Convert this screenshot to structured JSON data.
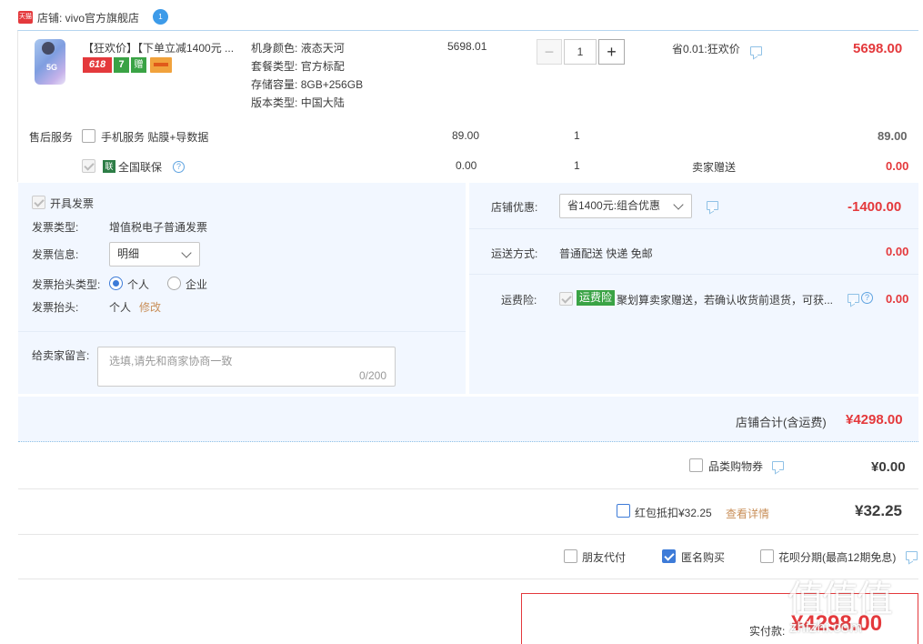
{
  "shop": {
    "icon_text": "天猫",
    "label": "店铺: vivo官方旗舰店",
    "badge": "1"
  },
  "product": {
    "title": "【狂欢价】【下单立减1400元 ...",
    "badges": [
      "618",
      "7",
      "赠",
      "卡"
    ],
    "specs": [
      {
        "key": "机身颜色:",
        "value": "液态天河"
      },
      {
        "key": "套餐类型:",
        "value": "官方标配"
      },
      {
        "key": "存储容量:",
        "value": "8GB+256GB"
      },
      {
        "key": "版本类型:",
        "value": "中国大陆"
      }
    ],
    "unit_price": "5698.01",
    "qty": "1",
    "minus": "−",
    "plus": "+",
    "promo": "省0.01:狂欢价",
    "subtotal": "5698.00"
  },
  "aftersale": {
    "label": "售后服务",
    "service1": {
      "name": "手机服务 贴膜+导数据",
      "price": "89.00",
      "qty": "1",
      "total": "89.00"
    },
    "service2": {
      "icon": "联",
      "name": "全国联保",
      "price": "0.00",
      "qty": "1",
      "note": "卖家赠送",
      "total": "0.00"
    }
  },
  "invoice": {
    "toggle": "开具发票",
    "type_label": "发票类型:",
    "type_value": "增值税电子普通发票",
    "info_label": "发票信息:",
    "info_value": "明细",
    "header_type_label": "发票抬头类型:",
    "opt_personal": "个人",
    "opt_company": "企业",
    "header_label": "发票抬头:",
    "header_value": "个人",
    "edit": "修改"
  },
  "message": {
    "label": "给卖家留言:",
    "placeholder": "选填,请先和商家协商一致",
    "counter": "0/200"
  },
  "discount": {
    "label": "店铺优惠:",
    "value": "省1400元:组合优惠",
    "amount": "-1400.00"
  },
  "shipping": {
    "label": "运送方式:",
    "value": "普通配送 快递 免邮",
    "amount": "0.00"
  },
  "insurance": {
    "label": "运费险:",
    "tag": "运费险",
    "text": "聚划算卖家赠送，若确认收货前退货，可获...",
    "amount": "0.00"
  },
  "shop_total": {
    "label": "店铺合计(含运费)",
    "value": "¥4298.00"
  },
  "coupon": {
    "label": "品类购物券",
    "value": "¥0.00"
  },
  "redpacket": {
    "label": "红包抵扣¥32.25",
    "link": "查看详情",
    "value": "¥32.25"
  },
  "options": {
    "friend_pay": "朋友代付",
    "anonymous": "匿名购买",
    "huabei": "花呗分期(最高12期免息)"
  },
  "final": {
    "label": "实付款:",
    "value": "¥4298.00"
  },
  "watermark": {
    "text": "值值值",
    "site": "zhizhi.com"
  },
  "colors": {
    "price_red": "#e4393c",
    "panel_bg": "#f2f7ff",
    "accent_blue": "#3d7bd8",
    "tag_green": "#3aa345"
  }
}
